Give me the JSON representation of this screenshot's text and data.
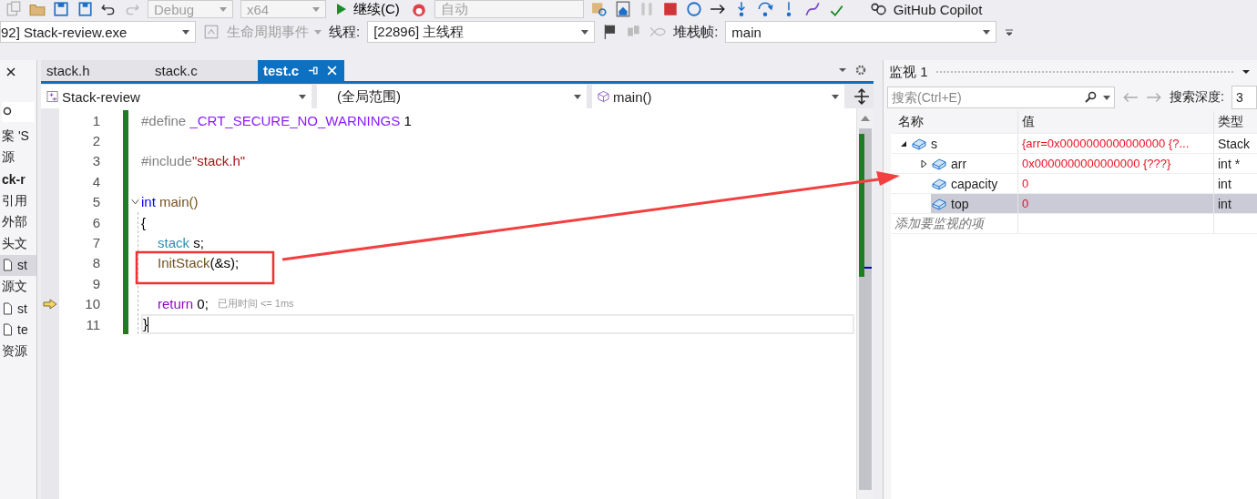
{
  "toolbar": {
    "combos": [
      {
        "label": "Debug",
        "disabled": true
      },
      {
        "label": "x64",
        "disabled": true
      }
    ],
    "continue_button": "继续(C)",
    "auto_combo": {
      "label": "自动",
      "disabled": true
    },
    "copilot": "GitHub Copilot"
  },
  "debug_bar": {
    "process": "92] Stack-review.exe",
    "lifecycle_events": "生命周期事件",
    "thread_label": "线程:",
    "thread": "[22896] 主线程",
    "stack_frame_label": "堆栈帧:",
    "stack_frame": "main"
  },
  "solution_explorer": {
    "items": [
      {
        "label": "案 'S",
        "kind": "text",
        "selected": false
      },
      {
        "label": "源",
        "kind": "text",
        "selected": false
      },
      {
        "label": "ck-r",
        "kind": "project",
        "selected": false
      },
      {
        "label": "引用",
        "kind": "text",
        "selected": false
      },
      {
        "label": "外部",
        "kind": "text",
        "selected": false
      },
      {
        "label": "头文",
        "kind": "text",
        "selected": false
      },
      {
        "label": "st",
        "kind": "file",
        "selected": true
      },
      {
        "label": "源文",
        "kind": "text",
        "selected": false
      },
      {
        "label": "st",
        "kind": "file",
        "selected": false
      },
      {
        "label": "te",
        "kind": "file",
        "selected": false
      },
      {
        "label": "资源",
        "kind": "text",
        "selected": false
      }
    ]
  },
  "editor": {
    "tabs": [
      {
        "label": "stack.h",
        "selected": false
      },
      {
        "label": "stack.c",
        "selected": false
      },
      {
        "label": "test.c",
        "selected": true
      }
    ],
    "nav": {
      "project": "Stack-review",
      "scope": "(全局范围)",
      "member": "main()"
    },
    "lines": [
      {
        "number": "1",
        "indented": false,
        "tokens": [
          {
            "text": "#define ",
            "kind": "pre"
          },
          {
            "text": "_CRT_SECURE_NO_WARNINGS",
            "kind": "macro"
          },
          {
            "text": " 1",
            "kind": "plain"
          }
        ]
      },
      {
        "number": "2"
      },
      {
        "number": "3",
        "indented": false,
        "tokens": [
          {
            "text": "#include",
            "kind": "pre"
          },
          {
            "text": "\"stack.h\"",
            "kind": "string"
          }
        ]
      },
      {
        "number": "4"
      },
      {
        "number": "5",
        "indented": false,
        "fold": true,
        "tokens": [
          {
            "text": "int",
            "kind": "keyword"
          },
          {
            "text": " main()",
            "kind": "function"
          }
        ]
      },
      {
        "number": "6",
        "indented": false,
        "tokens": [
          {
            "text": "{",
            "kind": "plain"
          }
        ]
      },
      {
        "number": "7",
        "indented": true,
        "tokens": [
          {
            "text": "stack",
            "kind": "type"
          },
          {
            "text": " s;",
            "kind": "plain"
          }
        ]
      },
      {
        "number": "8",
        "indented": true,
        "tokens": [
          {
            "text": "InitStack",
            "kind": "function"
          },
          {
            "text": "(&s);",
            "kind": "plain"
          }
        ]
      },
      {
        "number": "9"
      },
      {
        "number": "10",
        "indented": true,
        "current": true,
        "hint": "已用时间 <= 1ms",
        "tokens": [
          {
            "text": "return",
            "kind": "control"
          },
          {
            "text": " 0;",
            "kind": "plain"
          }
        ]
      },
      {
        "number": "11",
        "indented": false,
        "caret": true,
        "tokens": [
          {
            "text": "}",
            "kind": "plain"
          }
        ]
      }
    ]
  },
  "watch": {
    "title": "监视 1",
    "search": {
      "placeholder": "搜索(Ctrl+E)"
    },
    "depth_label": "搜索深度:",
    "depth": "3",
    "columns": [
      "名称",
      "值",
      "类型"
    ],
    "rows": [
      {
        "name": "s",
        "value": "{arr=0x0000000000000000 {?...",
        "type": "Stack",
        "expanded": true,
        "selected": false,
        "children": [
          {
            "name": "arr",
            "value": "0x0000000000000000 {???}",
            "type": "int *",
            "expanded": false,
            "selected": false
          },
          {
            "name": "capacity",
            "value": "0",
            "type": "int",
            "selected": false
          },
          {
            "name": "top",
            "value": "0",
            "type": "int",
            "selected": true
          }
        ]
      }
    ],
    "add_placeholder": "添加要监视的项"
  }
}
